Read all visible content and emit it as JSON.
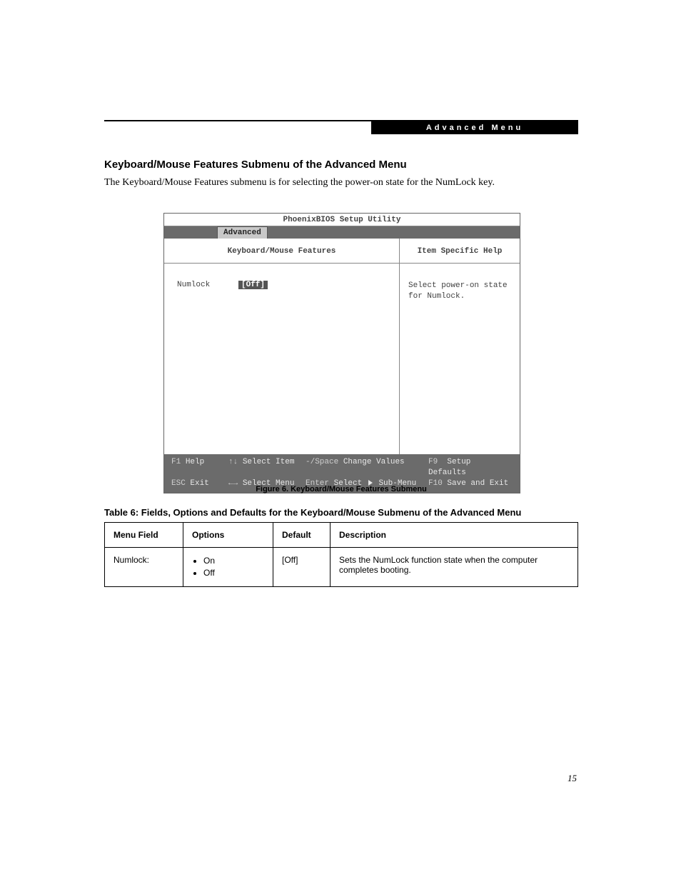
{
  "header": {
    "bar": "Advanced Menu"
  },
  "section": {
    "title": "Keyboard/Mouse Features Submenu of the Advanced Menu",
    "desc": "The Keyboard/Mouse Features submenu is for selecting the power-on state for the NumLock key."
  },
  "bios": {
    "title": "PhoenixBIOS Setup Utility",
    "tab_active": "Advanced",
    "panel_title": "Keyboard/Mouse Features",
    "help_title": "Item Specific Help",
    "help_text": "Select power-on state for Numlock.",
    "field": {
      "label": "Numlock",
      "value": "[Off]"
    },
    "footer": {
      "r1": {
        "c1_key": "F1",
        "c1_txt": "Help",
        "c2_key": "↑↓",
        "c2_txt": "Select Item",
        "c3_key": "-/Space",
        "c3_txt": "Change Values",
        "c4_key": "F9",
        "c4_txt": "Setup Defaults"
      },
      "r2": {
        "c1_key": "ESC",
        "c1_txt": "Exit",
        "c2_key": "←→",
        "c2_txt": "Select Menu",
        "c3_key": "Enter",
        "c3_txt_a": "Select",
        "c3_txt_b": "Sub-Menu",
        "c4_key": "F10",
        "c4_txt": "Save and Exit"
      }
    }
  },
  "figure_caption": "Figure 6.  Keyboard/Mouse Features Submenu",
  "table": {
    "title": "Table 6: Fields, Options and Defaults for the Keyboard/Mouse Submenu of the Advanced Menu",
    "headers": {
      "mf": "Menu Field",
      "opt": "Options",
      "def": "Default",
      "desc": "Description"
    },
    "rows": [
      {
        "mf": "Numlock:",
        "options": [
          "On",
          "Off"
        ],
        "def": "[Off]",
        "desc": "Sets the NumLock function state when the computer completes booting."
      }
    ]
  },
  "page_num": "15"
}
